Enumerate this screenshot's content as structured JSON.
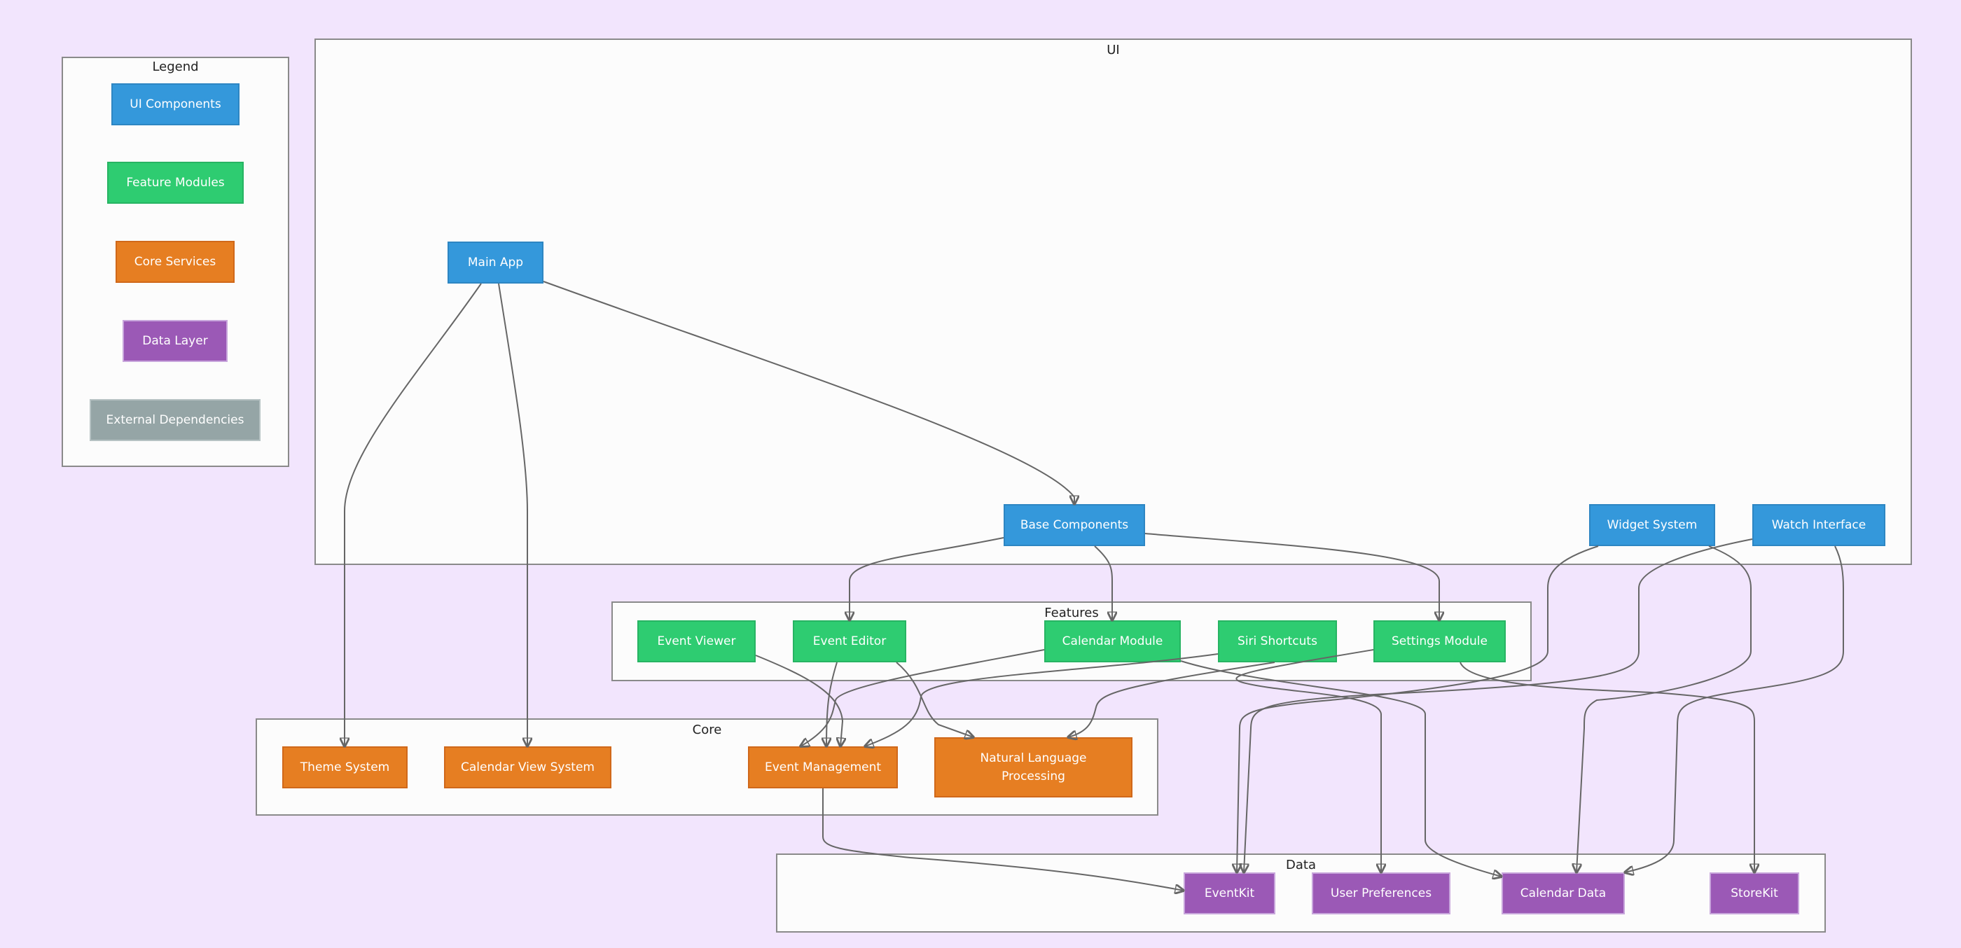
{
  "legend": {
    "title": "Legend",
    "items": [
      {
        "label": "UI Components",
        "color": "#3498db"
      },
      {
        "label": "Feature Modules",
        "color": "#2ecc71"
      },
      {
        "label": "Core Services",
        "color": "#e67e22"
      },
      {
        "label": "Data Layer",
        "color": "#9b59b6"
      },
      {
        "label": "External Dependencies",
        "color": "#95a5a6"
      }
    ]
  },
  "clusters": {
    "ui": {
      "title": "UI"
    },
    "features": {
      "title": "Features"
    },
    "core": {
      "title": "Core"
    },
    "data": {
      "title": "Data"
    }
  },
  "nodes": {
    "main_app": "Main App",
    "base_components": "Base Components",
    "widget_system": "Widget System",
    "watch_interface": "Watch Interface",
    "event_viewer": "Event Viewer",
    "event_editor": "Event Editor",
    "calendar_module": "Calendar Module",
    "siri_shortcuts": "Siri Shortcuts",
    "settings_module": "Settings Module",
    "theme_system": "Theme System",
    "calendar_view_system": "Calendar View System",
    "event_management": "Event Management",
    "nlp": "Natural Language Processing",
    "eventkit": "EventKit",
    "user_preferences": "User Preferences",
    "calendar_data": "Calendar Data",
    "storekit": "StoreKit"
  },
  "edges": [
    {
      "from": "main_app",
      "to": "theme_system"
    },
    {
      "from": "main_app",
      "to": "calendar_view_system"
    },
    {
      "from": "main_app",
      "to": "base_components"
    },
    {
      "from": "base_components",
      "to": "event_editor"
    },
    {
      "from": "base_components",
      "to": "calendar_module"
    },
    {
      "from": "base_components",
      "to": "settings_module"
    },
    {
      "from": "event_viewer",
      "to": "event_management"
    },
    {
      "from": "event_editor",
      "to": "event_management"
    },
    {
      "from": "event_editor",
      "to": "nlp"
    },
    {
      "from": "calendar_module",
      "to": "event_management"
    },
    {
      "from": "calendar_module",
      "to": "calendar_data"
    },
    {
      "from": "siri_shortcuts",
      "to": "event_management"
    },
    {
      "from": "siri_shortcuts",
      "to": "nlp"
    },
    {
      "from": "settings_module",
      "to": "user_preferences"
    },
    {
      "from": "settings_module",
      "to": "storekit"
    },
    {
      "from": "widget_system",
      "to": "eventkit"
    },
    {
      "from": "widget_system",
      "to": "calendar_data"
    },
    {
      "from": "watch_interface",
      "to": "eventkit"
    },
    {
      "from": "watch_interface",
      "to": "calendar_data"
    },
    {
      "from": "event_management",
      "to": "eventkit"
    }
  ]
}
